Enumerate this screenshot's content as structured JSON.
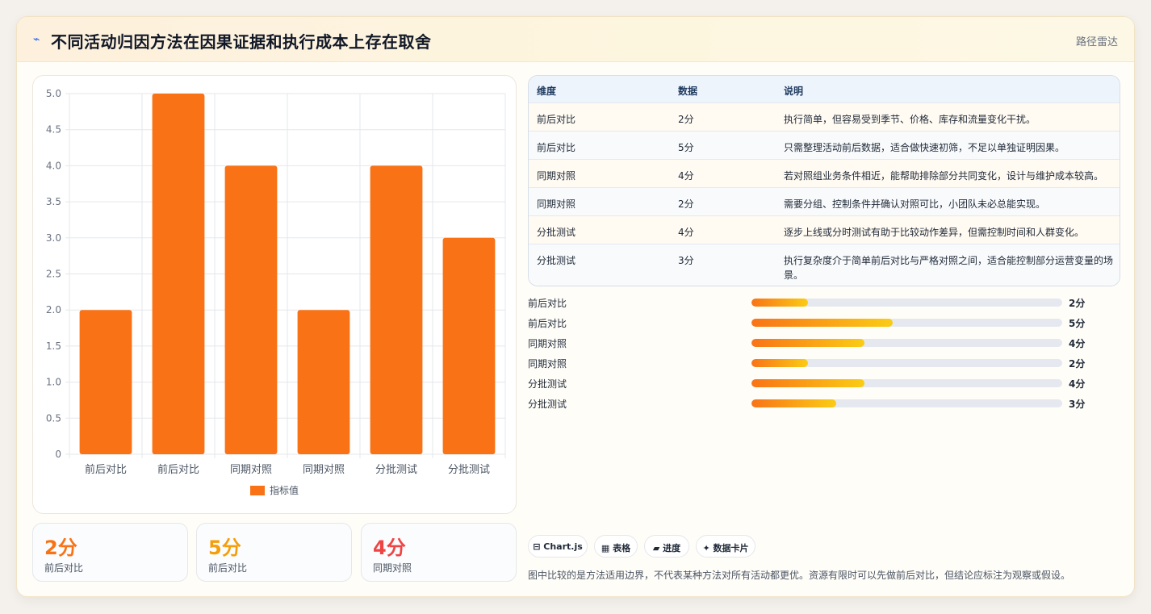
{
  "header": {
    "icon": "⌁",
    "title": "不同活动归因方法在因果证据和执行成本上存在取舍",
    "tag": "路径雷达"
  },
  "colors": {
    "accent": "#f97316",
    "bar": "#f97316",
    "stat_colors": [
      "#f97316",
      "#f59e0b",
      "#ef4444"
    ]
  },
  "chart_data": {
    "type": "bar",
    "categories": [
      "前后对比",
      "前后对比",
      "同期对照",
      "同期对照",
      "分批测试",
      "分批测试"
    ],
    "series": [
      {
        "name": "指标值",
        "values": [
          2,
          5,
          4,
          2,
          4,
          3
        ]
      }
    ],
    "ylim": [
      0,
      5
    ],
    "yticks": [
      "0",
      "0.5",
      "1.0",
      "1.5",
      "2.0",
      "2.5",
      "3.0",
      "3.5",
      "4.0",
      "4.5",
      "5.0"
    ],
    "grid": true,
    "legend": "bottom"
  },
  "stats": [
    {
      "value": "2分",
      "label": "前后对比"
    },
    {
      "value": "5分",
      "label": "前后对比"
    },
    {
      "value": "4分",
      "label": "同期对照"
    }
  ],
  "table": {
    "headers": [
      "维度",
      "数据",
      "说明"
    ],
    "rows": [
      [
        "前后对比",
        "2分",
        "执行简单，但容易受到季节、价格、库存和流量变化干扰。"
      ],
      [
        "前后对比",
        "5分",
        "只需整理活动前后数据，适合做快速初筛，不足以单独证明因果。"
      ],
      [
        "同期对照",
        "4分",
        "若对照组业务条件相近，能帮助排除部分共同变化，设计与维护成本较高。"
      ],
      [
        "同期对照",
        "2分",
        "需要分组、控制条件并确认对照可比，小团队未必总能实现。"
      ],
      [
        "分批测试",
        "4分",
        "逐步上线或分时测试有助于比较动作差异，但需控制时间和人群变化。"
      ],
      [
        "分批测试",
        "3分",
        "执行复杂度介于简单前后对比与严格对照之间，适合能控制部分运营变量的场景。"
      ]
    ]
  },
  "progress": [
    {
      "label": "前后对比",
      "value": 2,
      "max": 11,
      "text": "2分"
    },
    {
      "label": "前后对比",
      "value": 5,
      "max": 11,
      "text": "5分"
    },
    {
      "label": "同期对照",
      "value": 4,
      "max": 11,
      "text": "4分"
    },
    {
      "label": "同期对照",
      "value": 2,
      "max": 11,
      "text": "2分"
    },
    {
      "label": "分批测试",
      "value": 4,
      "max": 11,
      "text": "4分"
    },
    {
      "label": "分批测试",
      "value": 3,
      "max": 11,
      "text": "3分"
    }
  ],
  "chips": [
    "⊟ Chart.js",
    "▦ 表格",
    "▰ 进度",
    "✦ 数据卡片"
  ],
  "footnote": "图中比较的是方法适用边界，不代表某种方法对所有活动都更优。资源有限时可以先做前后对比，但结论应标注为观察或假设。"
}
